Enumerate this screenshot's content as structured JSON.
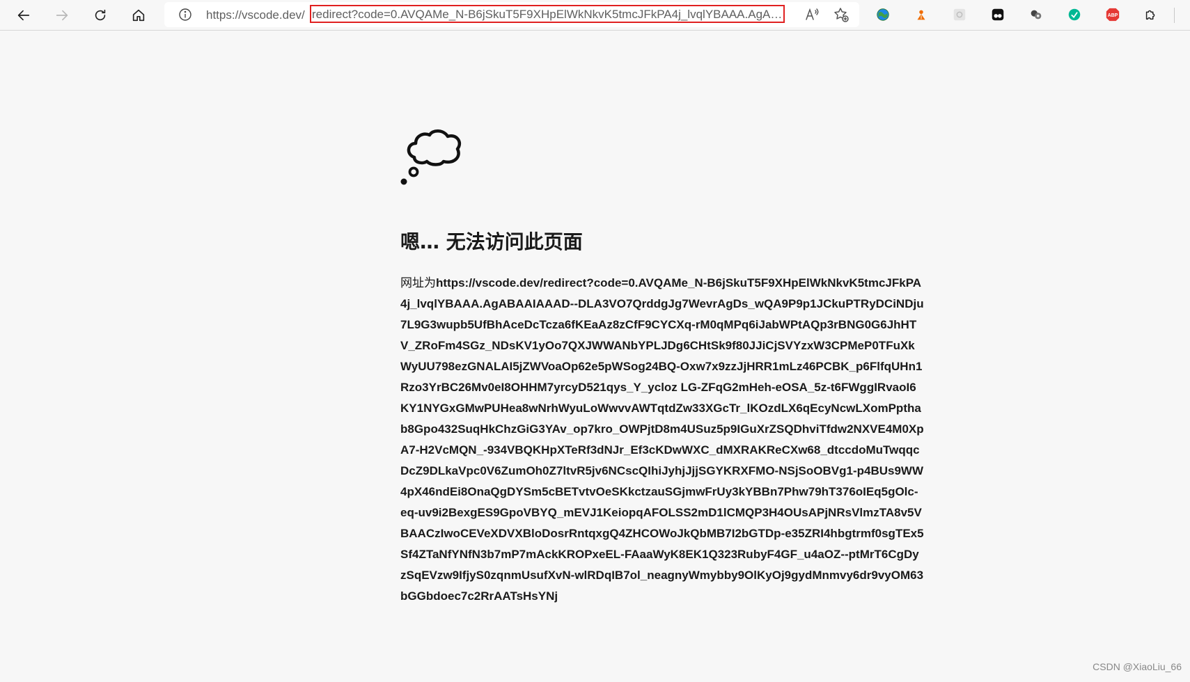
{
  "address_bar": {
    "url_origin": "https://vscode.dev/",
    "url_path": "redirect?code=0.AVQAMe_N-B6jSkuT5F9XHpElWkNkvK5tmcJFkPA4j_lvqlYBAAA.AgABA..."
  },
  "icons": {
    "back": "back-arrow-icon",
    "forward": "forward-arrow-icon",
    "refresh": "refresh-icon",
    "home": "home-icon",
    "info": "info-icon",
    "read_aloud": "read-aloud-icon",
    "favorites": "add-favorite-icon",
    "extensions_menu": "extensions-puzzle-icon"
  },
  "extensions": [
    {
      "name": "extension-globe-icon",
      "color": "#2e7d32"
    },
    {
      "name": "extension-person-icon",
      "color": "#e65100"
    },
    {
      "name": "extension-gray-icon",
      "color": "#c8c8c8"
    },
    {
      "name": "extension-black-square-icon",
      "color": "#111111"
    },
    {
      "name": "extension-cluster-icon",
      "color": "#333333"
    },
    {
      "name": "extension-green-circle-icon",
      "color": "#00b894"
    },
    {
      "name": "extension-abp-icon",
      "color": "#e53935",
      "label": "ABP"
    }
  ],
  "error": {
    "title": "嗯… 无法访问此页面",
    "prefix": "网址为",
    "url": "https://vscode.dev/redirect?code=0.AVQAMe_N-B6jSkuT5F9XHpElWkNkvK5tmcJFkPA4j_lvqlYBAAA.AgABAAIAAAD--DLA3VO7QrddgJg7WevrAgDs_wQA9P9p1JCkuPTRyDCiNDju7L9G3wupb5UfBhAceDcTcza6fKEaAz8zCfF9CYCXq-rM0qMPq6iJabWPtAQp3rBNG0G6JhHTV_ZRoFm4SGz_NDsKV1yOo7QXJWWANbYPLJDg6CHtSk9f80JJiCjSVYzxW3CPMeP0TFuXkWyUU798ezGNALAI5jZWVoaOp62e5pWSog24BQ-Oxw7x9zzJjHRR1mLz46PCBK_p6FlfqUHn1Rzo3YrBC26Mv0eI8OHHM7yrcyD521qys_Y_ycloz LG-ZFqG2mHeh-eOSA_5z-t6FWggIRvaoI6KY1NYGxGMwPUHea8wNrhWyuLoWwvvAWTqtdZw33XGcTr_lKOzdLX6qEcyNcwLXomPpthab8Gpo432SuqHkChzGiG3YAv_op7kro_OWPjtD8m4USuz5p9IGuXrZSQDhviTfdw2NXVE4M0XpA7-H2VcMQN_-934VBQKHpXTeRf3dNJr_Ef3cKDwWXC_dMXRAKReCXw68_dtccdoMuTwqqcDcZ9DLkaVpc0V6ZumOh0Z7ltvR5jv6NCscQIhiJyhjJjjSGYKRXFMO-NSjSoOBVg1-p4BUs9WW4pX46ndEi8OnaQgDYSm5cBETvtvOeSKkctzauSGjmwFrUy3kYBBn7Phw79hT376oIEq5gOlc-eq-uv9i2BexgES9GpoVBYQ_mEVJ1KeiopqAFOLSS2mD1lCMQP3H4OUsAPjNRsVlmzTA8v5VBAACzIwoCEVeXDVXBloDosrRntqxgQ4ZHCOWoJkQbMB7I2bGTDp-e35ZRI4hbgtrmf0sgTEx5Sf4ZTaNfYNfN3b7mP7mAckKROPxeEL-FAaaWyK8EK1Q323RubyF4GF_u4aOZ--ptMrT6CgDyzSqEVzw9IfjyS0zqnmUsufXvN-wlRDqIB7ol_neagnyWmybby9OlKyOj9gydMnmvy6dr9vyOM63bGGbdoec7c2RrAATsHsYNj"
  },
  "watermark": "CSDN @XiaoLiu_66"
}
